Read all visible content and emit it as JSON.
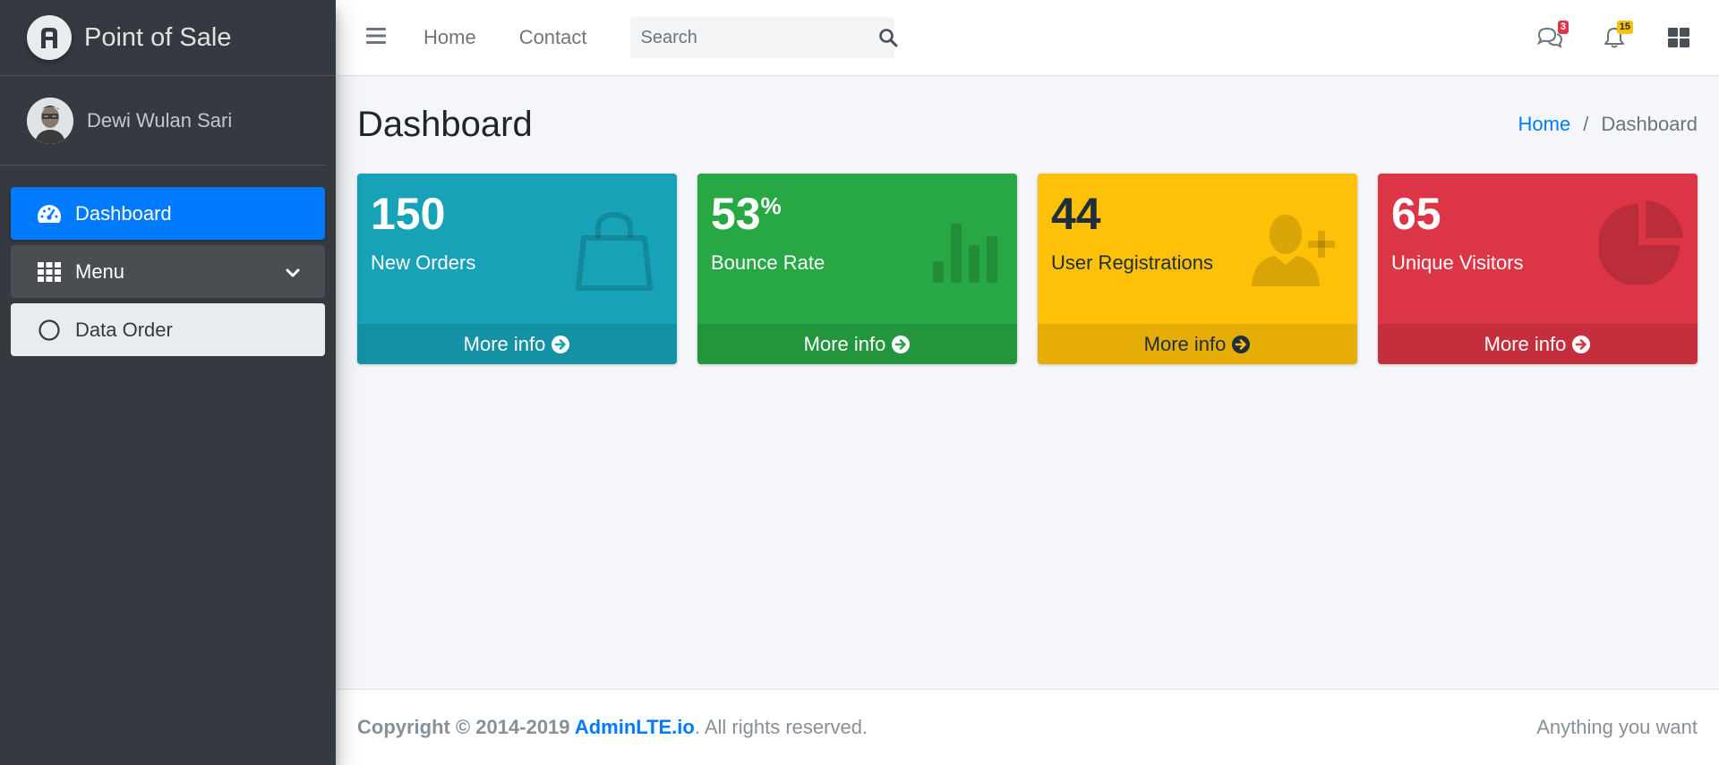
{
  "brand": {
    "name": "Point of Sale",
    "logo_icon": "adminlte-logo-icon"
  },
  "user": {
    "name": "Dewi Wulan Sari"
  },
  "sidebar": {
    "items": [
      {
        "label": "Dashboard",
        "icon": "tachometer-icon",
        "state": "active"
      },
      {
        "label": "Menu",
        "icon": "grid-icon",
        "state": "open"
      },
      {
        "label": "Data Order",
        "icon": "circle-icon",
        "state": "sub"
      }
    ]
  },
  "navbar": {
    "links": [
      "Home",
      "Contact"
    ],
    "search_placeholder": "Search",
    "messages_count": "3",
    "notifications_count": "15"
  },
  "page": {
    "title": "Dashboard",
    "breadcrumb": [
      "Home",
      "Dashboard"
    ]
  },
  "boxes": [
    {
      "value": "150",
      "suffix": "",
      "label": "New Orders",
      "footer": "More info",
      "color": "#17a2b8",
      "icon": "shopping-bag-icon"
    },
    {
      "value": "53",
      "suffix": "%",
      "label": "Bounce Rate",
      "footer": "More info",
      "color": "#28a745",
      "icon": "bar-chart-icon"
    },
    {
      "value": "44",
      "suffix": "",
      "label": "User Registrations",
      "footer": "More info",
      "color": "#ffc107",
      "icon": "user-plus-icon"
    },
    {
      "value": "65",
      "suffix": "",
      "label": "Unique Visitors",
      "footer": "More info",
      "color": "#dc3545",
      "icon": "pie-chart-icon"
    }
  ],
  "footer": {
    "copyright": "Copyright © 2014-2019",
    "brand_link": "AdminLTE.io",
    "rights": ". All rights reserved.",
    "right_text": "Anything you want"
  }
}
